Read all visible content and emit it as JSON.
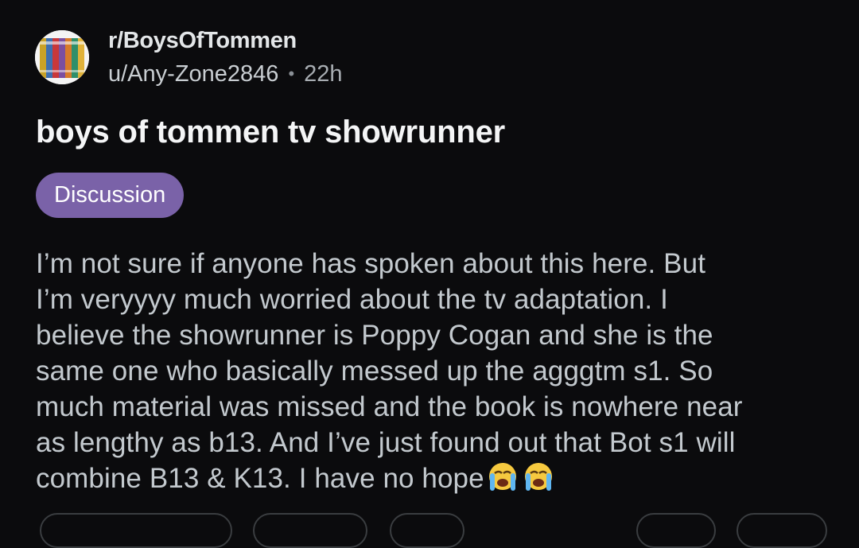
{
  "post": {
    "subreddit": "r/BoysOfTommen",
    "author": "u/Any-Zone2846",
    "separator": "•",
    "age": "22h",
    "avatar_icon": "book-stack-icon",
    "title": "boys of tommen tv showrunner",
    "flair": "Discussion",
    "flair_color": "#7a62a8",
    "body_lines": [
      "I’m not sure if anyone has spoken about this here. But",
      "I’m veryyyy much worried about the tv adaptation. I",
      "believe the showrunner is Poppy Cogan and she is the",
      "same one who basically messed up the agggtm s1. So",
      "much material was missed and the book is nowhere near",
      "as lengthy as b13. And I’ve just found out that Bot s1 will",
      "combine B13 & K13. I have no hope"
    ],
    "trailing_emoji": [
      "loudly-crying-face-icon",
      "loudly-crying-face-icon"
    ]
  },
  "colors": {
    "background": "#0b0b0d",
    "title": "#f4f5f6",
    "body": "#c3c9ce",
    "meta": "#c9ced2"
  }
}
